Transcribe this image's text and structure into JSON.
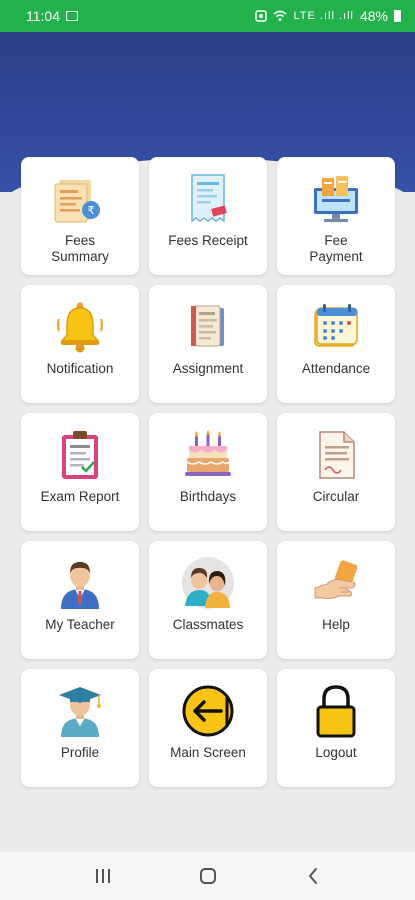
{
  "status_bar": {
    "time": "11:04",
    "signal": "LTE .ıll .ıll",
    "battery": "48%"
  },
  "colors": {
    "status_bar": "#22b14c",
    "header": "#32489a",
    "background": "#ebebeb",
    "tile": "#ffffff",
    "accent_yellow": "#f7c414"
  },
  "tiles": [
    {
      "label": "Fees\nSummary",
      "icon": "fees-summary-icon"
    },
    {
      "label": "Fees Receipt",
      "icon": "fees-receipt-icon"
    },
    {
      "label": "Fee\nPayment",
      "icon": "fee-payment-icon"
    },
    {
      "label": "Notification",
      "icon": "bell-icon"
    },
    {
      "label": "Assignment",
      "icon": "assignment-icon"
    },
    {
      "label": "Attendance",
      "icon": "calendar-icon"
    },
    {
      "label": "Exam Report",
      "icon": "clipboard-icon"
    },
    {
      "label": "Birthdays",
      "icon": "cake-icon"
    },
    {
      "label": "Circular",
      "icon": "document-icon"
    },
    {
      "label": "My Teacher",
      "icon": "teacher-icon"
    },
    {
      "label": "Classmates",
      "icon": "classmates-icon"
    },
    {
      "label": "Help",
      "icon": "help-hand-icon"
    },
    {
      "label": "Profile",
      "icon": "graduate-icon"
    },
    {
      "label": "Main Screen",
      "icon": "arrow-left-circle-icon"
    },
    {
      "label": "Logout",
      "icon": "padlock-icon"
    }
  ],
  "navbar": {
    "recents": "recents-icon",
    "home": "home-icon",
    "back": "back-icon"
  }
}
